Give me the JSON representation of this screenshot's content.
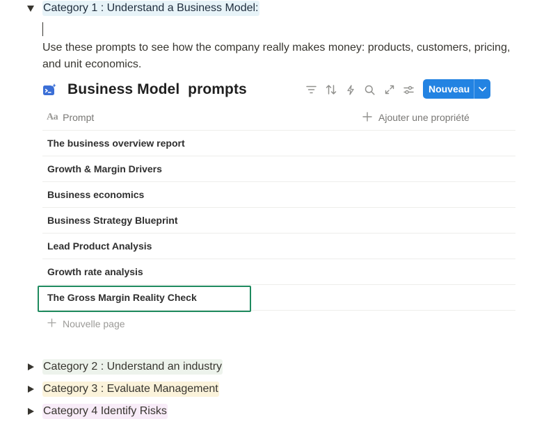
{
  "categories": {
    "cat1": "Category 1 : Understand a Business Model:",
    "cat2": "Category 2 : Understand  an industry",
    "cat3": "Category 3 : Evaluate Management",
    "cat4": "Category 4 Identify Risks"
  },
  "description": "Use these prompts to see how the company really makes money: products, customers, pricing, and unit economics.",
  "database": {
    "title": "Business Model  prompts",
    "new_button": "Nouveau",
    "column_prompt": "Prompt",
    "column_prompt_icon": "Aa",
    "add_property": "Ajouter une propriété",
    "rows": [
      "The business overview report",
      "Growth & Margin Drivers",
      "Business economics",
      "Business Strategy Blueprint",
      "Lead Product Analysis",
      "Growth rate analysis",
      "The Gross Margin Reality Check"
    ],
    "new_page": "Nouvelle page"
  },
  "colors": {
    "accent": "#2383e2",
    "selection": "#1e8a5e",
    "cat1_bg": "#e7f3f8",
    "cat2_bg": "#edf3ec",
    "cat3_bg": "#fbf3db",
    "cat4_bg": "#f8ecf8"
  }
}
